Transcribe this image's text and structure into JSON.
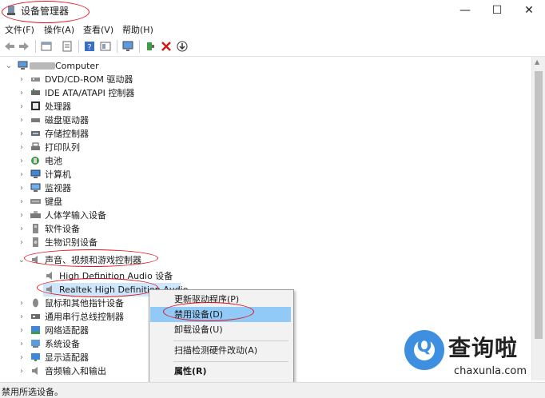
{
  "window": {
    "title": "设备管理器",
    "minimize": "—",
    "maximize": "☐",
    "close": "✕"
  },
  "menu": [
    {
      "label": "文件(F)"
    },
    {
      "label": "操作(A)"
    },
    {
      "label": "查看(V)"
    },
    {
      "label": "帮助(H)"
    }
  ],
  "toolbar": {
    "icons": [
      "back-arrow-icon",
      "forward-arrow-icon",
      "properties-icon",
      "update-driver-icon",
      "help-icon",
      "scan-hardware-icon",
      "monitor-icon",
      "add-driver-icon",
      "uninstall-x-icon",
      "disable-device-icon"
    ]
  },
  "tree": {
    "root": {
      "label": "Computer"
    },
    "categories": [
      {
        "label": "DVD/CD-ROM 驱动器",
        "icon": "dvd-drive-icon"
      },
      {
        "label": "IDE ATA/ATAPI 控制器",
        "icon": "ide-controller-icon"
      },
      {
        "label": "处理器",
        "icon": "processor-icon"
      },
      {
        "label": "磁盘驱动器",
        "icon": "disk-drive-icon"
      },
      {
        "label": "存储控制器",
        "icon": "storage-controller-icon"
      },
      {
        "label": "打印队列",
        "icon": "printer-icon"
      },
      {
        "label": "电池",
        "icon": "battery-icon"
      },
      {
        "label": "计算机",
        "icon": "computer-icon"
      },
      {
        "label": "监视器",
        "icon": "monitor-icon"
      },
      {
        "label": "键盘",
        "icon": "keyboard-icon"
      },
      {
        "label": "人体学输入设备",
        "icon": "hid-icon"
      },
      {
        "label": "软件设备",
        "icon": "software-device-icon"
      },
      {
        "label": "生物识别设备",
        "icon": "biometric-icon"
      },
      {
        "label": "声音、视频和游戏控制器",
        "icon": "speaker-icon",
        "expanded": true
      }
    ],
    "sound_children": [
      {
        "label": "High Definition Audio 设备",
        "icon": "speaker-icon"
      },
      {
        "label": "Realtek High Definition Audio",
        "icon": "speaker-icon"
      }
    ],
    "after": [
      {
        "label": "鼠标和其他指针设备",
        "icon": "mouse-icon"
      },
      {
        "label": "通用串行总线控制器",
        "icon": "usb-icon"
      },
      {
        "label": "网络适配器",
        "icon": "network-adapter-icon"
      },
      {
        "label": "系统设备",
        "icon": "system-device-icon"
      },
      {
        "label": "显示适配器",
        "icon": "display-adapter-icon"
      },
      {
        "label": "音频输入和输出",
        "icon": "audio-io-icon"
      }
    ]
  },
  "context_menu": {
    "items": [
      {
        "label": "更新驱动程序(P)"
      },
      {
        "label": "禁用设备(D)",
        "highlighted": true
      },
      {
        "label": "卸载设备(U)"
      },
      {
        "label": "扫描检测硬件改动(A)"
      },
      {
        "label": "属性(R)"
      }
    ]
  },
  "status": {
    "text": "禁用所选设备。"
  },
  "watermark": {
    "title": "查询啦",
    "subtitle": "chaxunla.com"
  },
  "colors": {
    "highlight": "#91c9f7",
    "annotation": "#e0121e",
    "watermark": "#3e8fe0"
  }
}
